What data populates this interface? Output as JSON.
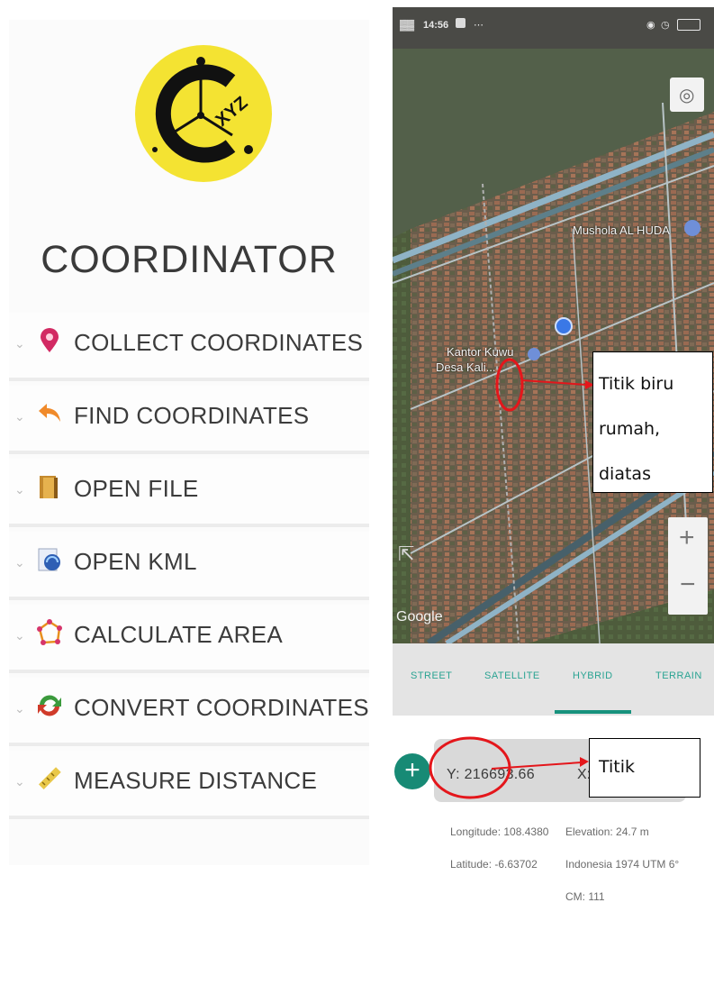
{
  "app": {
    "title": "COORDINATOR",
    "logo_text": "XYZ"
  },
  "menu": {
    "items": [
      {
        "label": "COLLECT COORDINATES",
        "icon": "map-pin-icon"
      },
      {
        "label": "FIND COORDINATES",
        "icon": "back-arrow-icon"
      },
      {
        "label": "OPEN FILE",
        "icon": "file-icon"
      },
      {
        "label": "OPEN KML",
        "icon": "kml-icon"
      },
      {
        "label": "CALCULATE AREA",
        "icon": "polygon-icon"
      },
      {
        "label": "CONVERT COORDINATES",
        "icon": "convert-icon"
      },
      {
        "label": "MEASURE DISTANCE",
        "icon": "ruler-icon"
      }
    ]
  },
  "phone": {
    "status": {
      "time": "14:56"
    },
    "map": {
      "labels": {
        "mosque": "Mushola AL HUDA",
        "office_line1": "Kantor Kuwu",
        "office_line2": "Desa Kali..."
      },
      "google": "Google",
      "zoom_in": "+",
      "zoom_out": "−"
    },
    "tabs": [
      "STREET",
      "SATELLITE",
      "HYBRID",
      "TERRAIN"
    ],
    "active_tab": "HYBRID",
    "coords": {
      "y": "Y: 216693.66",
      "x": "X:",
      "longitude": "Longitude:  108.4380",
      "latitude": "Latitude:   -6.63702",
      "elevation": "Elevation:     24.7 m",
      "datum": "Indonesia 1974 UTM 6°",
      "cm": "CM: 111"
    }
  },
  "annotations": {
    "note1_line1": "Titik biru",
    "note1_line2": "rumah,",
    "note1_line3": "diatas",
    "note2": "Titik"
  },
  "colors": {
    "accent": "#17927d",
    "logo_yellow": "#f4e332",
    "annotation_red": "#e4161b"
  }
}
